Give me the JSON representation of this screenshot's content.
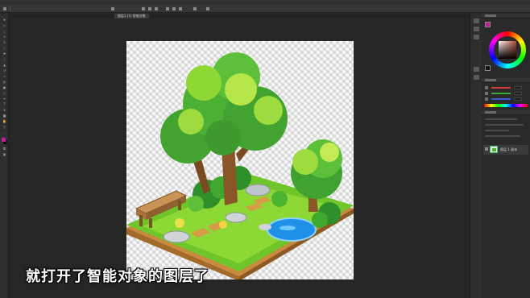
{
  "document": {
    "tab_label": "图层1 (1) 智能对象"
  },
  "subtitle": "就打开了智能对象的图层了",
  "layers": {
    "selected_name": "图层 1 副本"
  },
  "colors": {
    "foreground": "#c01f93",
    "background": "#111111",
    "selection_accent": "#3ac45a"
  },
  "icons": [
    "move-tool-icon",
    "marquee-tool-icon",
    "lasso-tool-icon",
    "magic-wand-icon",
    "crop-tool-icon",
    "eyedropper-icon",
    "brush-icon",
    "stamp-icon",
    "eraser-icon",
    "gradient-icon",
    "text-tool-icon",
    "pen-tool-icon",
    "hand-tool-icon",
    "zoom-tool-icon"
  ]
}
